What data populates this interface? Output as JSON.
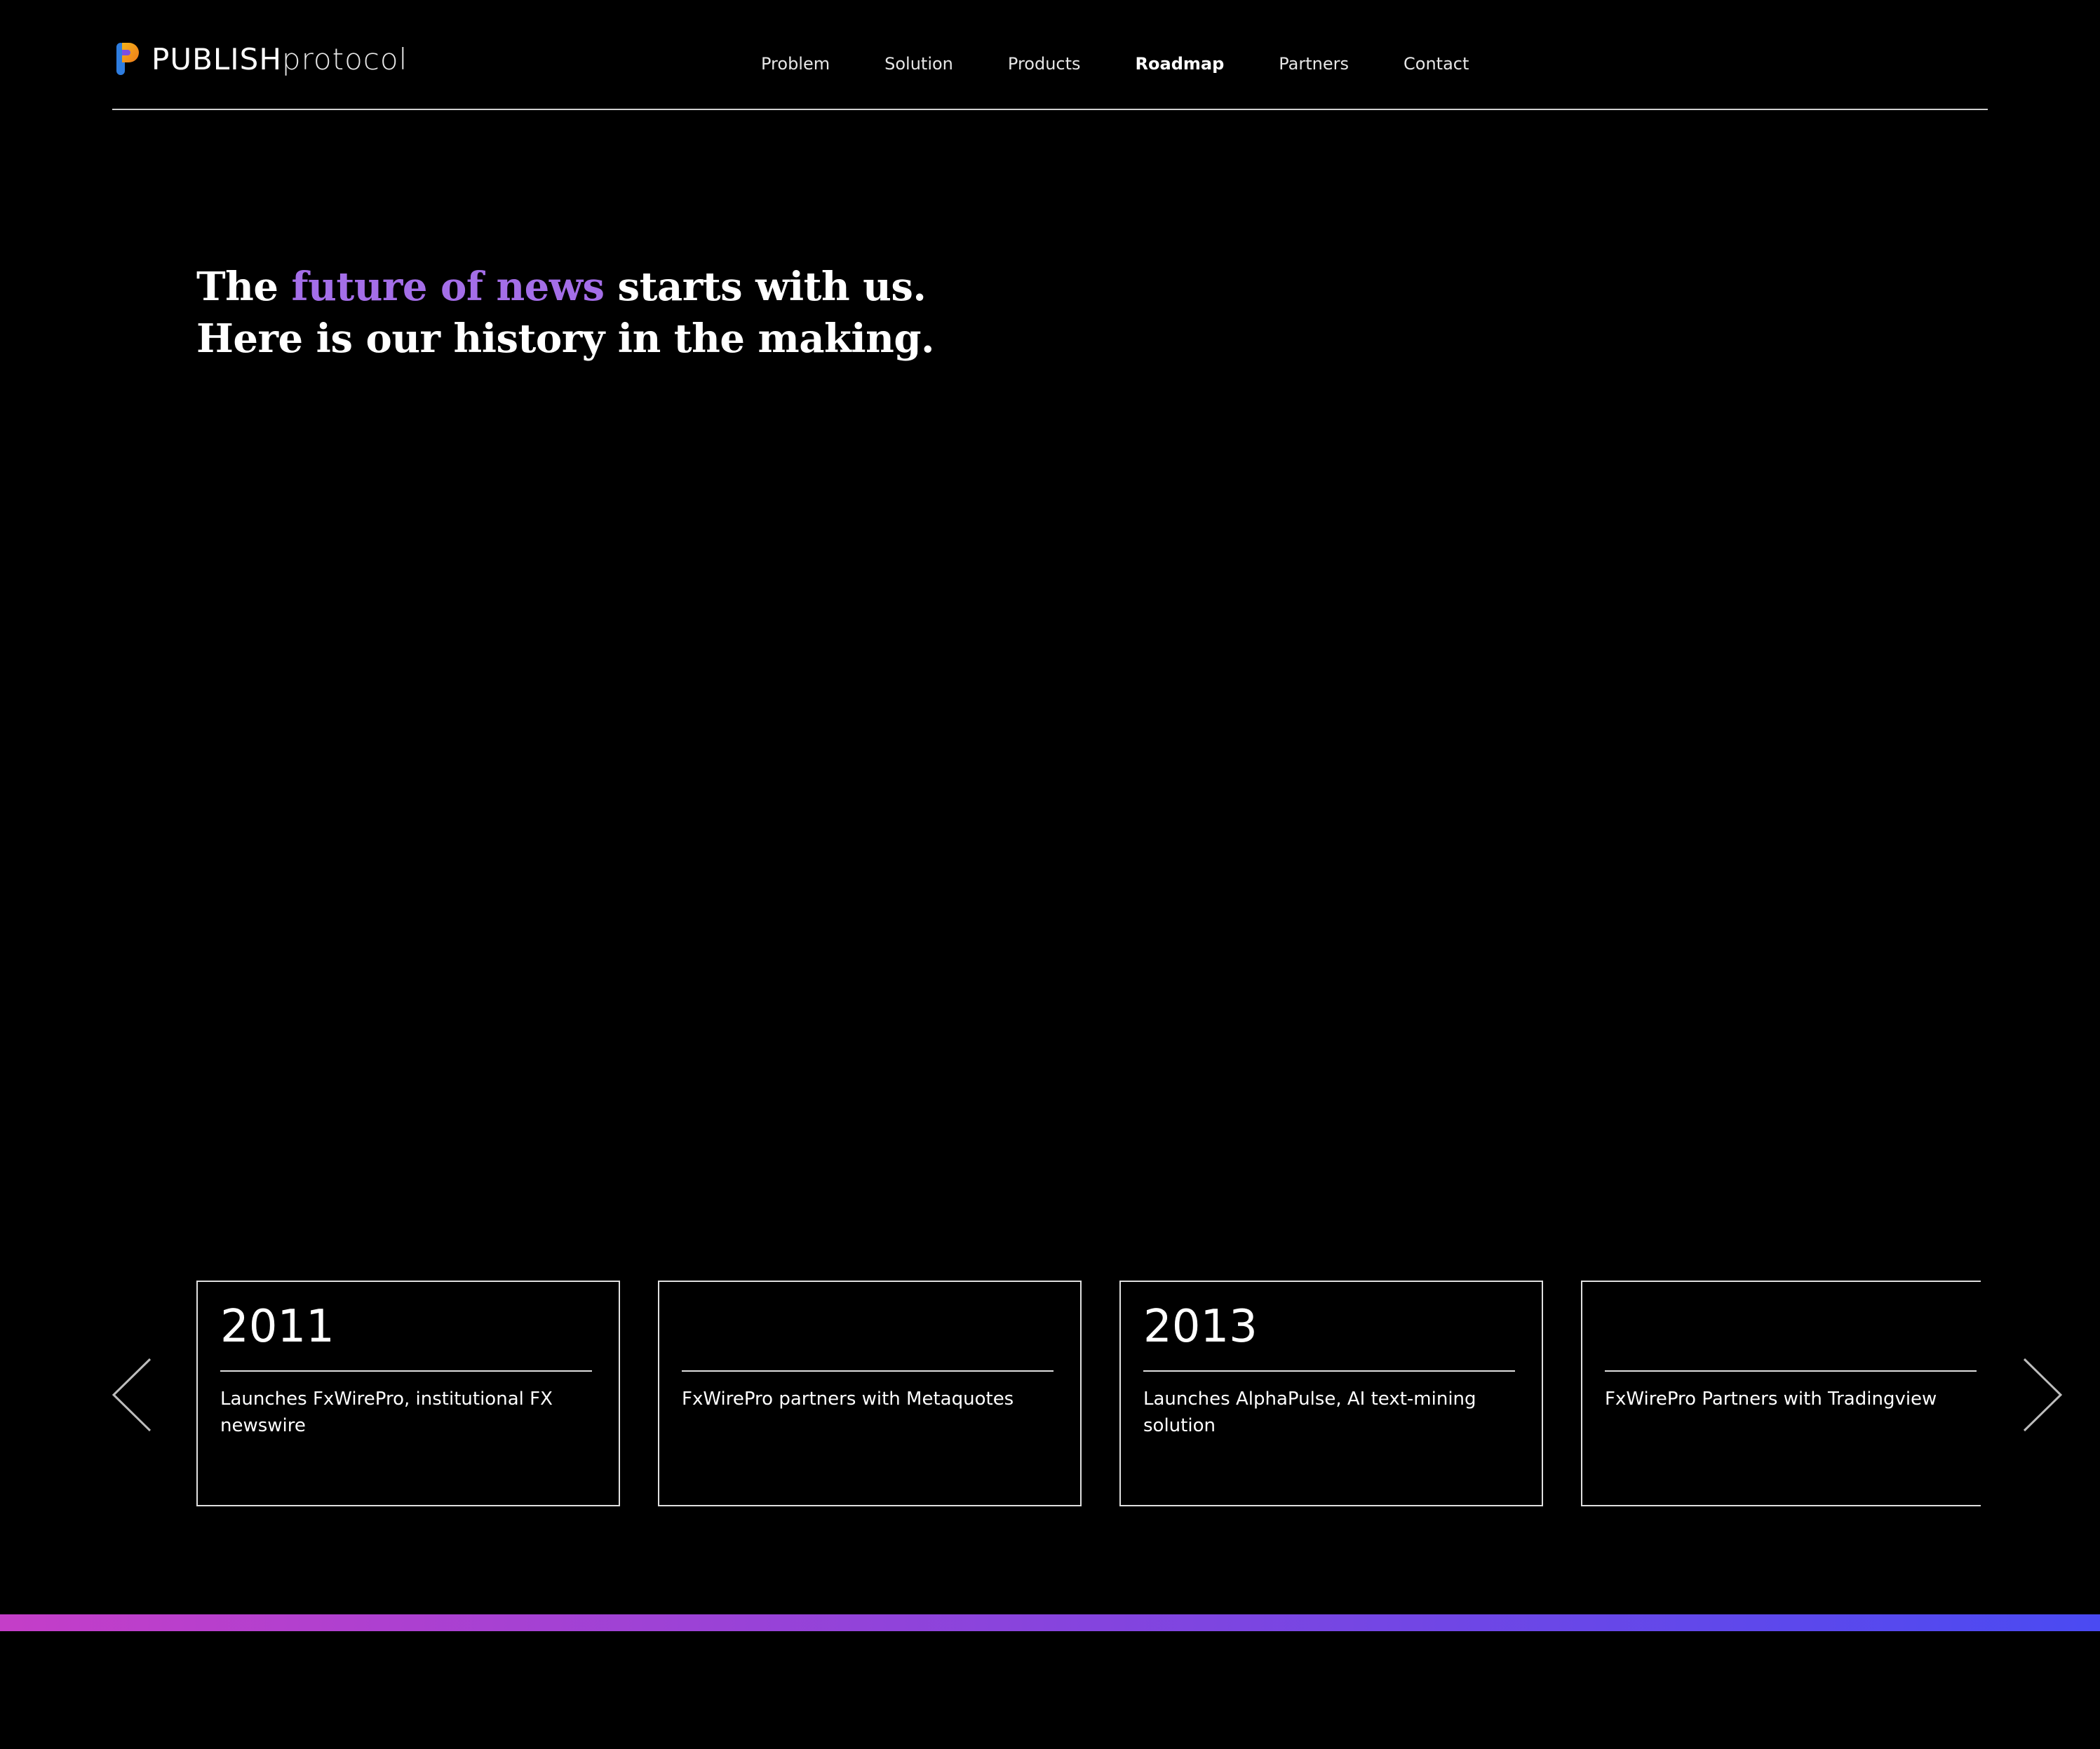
{
  "brand": {
    "name_strong": "PUBLISH",
    "name_light": "protocol",
    "logo_colors": [
      "#2e7de0",
      "#f2b21a",
      "#7c4fe0"
    ]
  },
  "nav": {
    "items": [
      {
        "label": "Problem",
        "active": false
      },
      {
        "label": "Solution",
        "active": false
      },
      {
        "label": "Products",
        "active": false
      },
      {
        "label": "Roadmap",
        "active": true
      },
      {
        "label": "Partners",
        "active": false
      },
      {
        "label": "Contact",
        "active": false
      }
    ]
  },
  "hero": {
    "line1_before": "The ",
    "line1_accent": "future of news",
    "line1_after": " starts with us.",
    "line2": "Here is our history in the making.",
    "accent_color": "#a46ee8"
  },
  "timeline": {
    "prev_icon": "chevron-left-icon",
    "next_icon": "chevron-right-icon",
    "cards": [
      {
        "year": "2011",
        "description": "Launches FxWirePro, institutional FX newswire"
      },
      {
        "year": "",
        "description": "FxWirePro partners with Metaquotes"
      },
      {
        "year": "2013",
        "description": "Launches AlphaPulse, AI text-mining solution"
      },
      {
        "year": "",
        "description": "FxWirePro Partners with Tradingview"
      }
    ]
  },
  "colors": {
    "background": "#000000",
    "gradient_start": "#c43ec8",
    "gradient_end": "#4a4af2"
  }
}
